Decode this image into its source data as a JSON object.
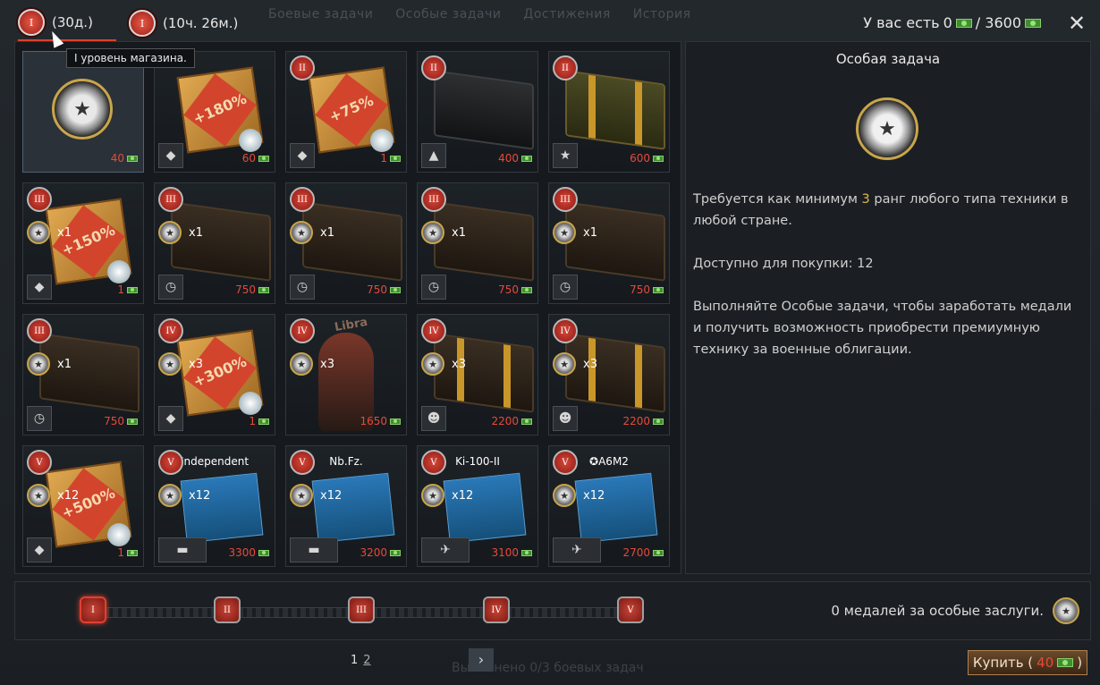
{
  "header": {
    "tabs": [
      {
        "rank": "I",
        "label": "(30д.)"
      },
      {
        "rank": "I",
        "label": "(10ч. 26м.)"
      }
    ],
    "bg_tabs": [
      "Боевые задачи",
      "Особые задачи",
      "Достижения",
      "История"
    ],
    "have_label": "У вас есть",
    "have_value": "0",
    "have_total": "/ 3600",
    "close_label": "✕"
  },
  "tooltip": "I уровень магазина.",
  "grid": {
    "cells": [
      {
        "rank": "",
        "price": "40",
        "type": "medal",
        "icon": "medal-icon"
      },
      {
        "rank": "",
        "price": "60",
        "type": "card",
        "pct": "+180%",
        "ti": "◆"
      },
      {
        "rank": "II",
        "price": "1",
        "type": "card",
        "pct": "+75%",
        "ti": "◆"
      },
      {
        "rank": "II",
        "price": "400",
        "type": "box-black",
        "ti": "▲"
      },
      {
        "rank": "II",
        "price": "600",
        "type": "box-gold",
        "ti": "★"
      },
      {
        "rank": "III",
        "price": "1",
        "type": "card",
        "pct": "+150%",
        "count": "x1",
        "ti": "◆"
      },
      {
        "rank": "III",
        "price": "750",
        "type": "box",
        "count": "x1",
        "ti": "◷"
      },
      {
        "rank": "III",
        "price": "750",
        "type": "box",
        "count": "x1",
        "ti": "◷"
      },
      {
        "rank": "III",
        "price": "750",
        "type": "box",
        "count": "x1",
        "ti": "◷"
      },
      {
        "rank": "III",
        "price": "750",
        "type": "box",
        "count": "x1",
        "ti": "◷"
      },
      {
        "rank": "III",
        "price": "750",
        "type": "box",
        "count": "x1",
        "ti": "◷"
      },
      {
        "rank": "IV",
        "price": "1",
        "type": "card",
        "pct": "+300%",
        "count": "x3",
        "ti": "◆"
      },
      {
        "rank": "IV",
        "price": "1650",
        "type": "pinup",
        "count": "x3",
        "decal": "Libra"
      },
      {
        "rank": "IV",
        "price": "2200",
        "type": "box-stripes",
        "count": "x3",
        "ti": "☻"
      },
      {
        "rank": "IV",
        "price": "2200",
        "type": "box-stripes",
        "count": "x3",
        "ti": "☻"
      },
      {
        "rank": "V",
        "price": "1",
        "type": "card",
        "pct": "+500%",
        "count": "x12",
        "ti": "◆"
      },
      {
        "rank": "V",
        "price": "3300",
        "type": "blueprint",
        "count": "x12",
        "title": "Independent",
        "ti": "▬"
      },
      {
        "rank": "V",
        "price": "3200",
        "type": "blueprint",
        "count": "x12",
        "title": "Nb.Fz.",
        "ti": "▬"
      },
      {
        "rank": "V",
        "price": "3100",
        "type": "blueprint",
        "count": "x12",
        "title": "Ki-100-II",
        "ti": "✈"
      },
      {
        "rank": "V",
        "price": "2700",
        "type": "blueprint",
        "count": "x12",
        "title": "✪A6M2",
        "ti": "✈"
      }
    ]
  },
  "panel": {
    "title": "Особая задача",
    "req_prefix": "Требуется как минимум",
    "req_rank": "3",
    "req_suffix": "ранг любого типа техники в любой стране.",
    "available": "Доступно для покупки: 12",
    "desc": "Выполняйте Особые задачи, чтобы заработать медали и получить возможность приобрести премиумную технику за военные облигации."
  },
  "progress": {
    "ranks": [
      "I",
      "II",
      "III",
      "IV",
      "V"
    ],
    "medals_text": "0 медалей за особые заслуги."
  },
  "footer": {
    "page1": "1",
    "page2": "2",
    "next": "›",
    "ghost_text": "Выполнено 0/3 боевых задач",
    "buy_label": "Купить (",
    "buy_price": "40",
    "buy_close": ")"
  },
  "colors": {
    "accent": "#e0402c",
    "price": "#e64a3a",
    "gold": "#e3b54a",
    "bond": "#3f8e2f"
  }
}
